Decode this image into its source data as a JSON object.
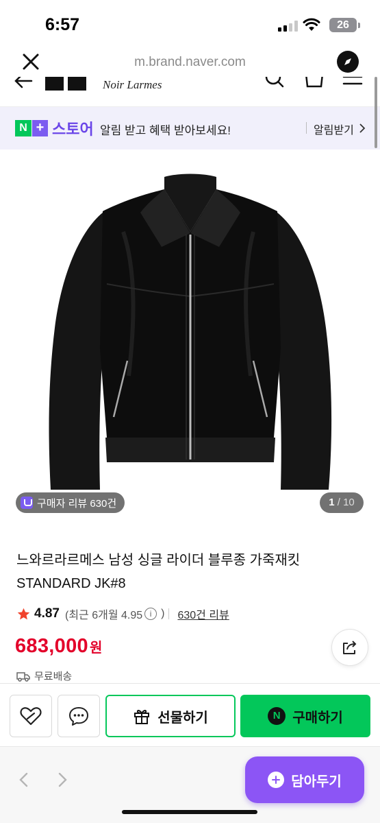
{
  "status_bar": {
    "time": "6:57",
    "battery": "26"
  },
  "browser": {
    "url": "m.brand.naver.com"
  },
  "site_header": {
    "brand": "Noir Larmes"
  },
  "store_banner": {
    "logo_n": "N",
    "logo_plus": "+",
    "store_name": "스토어",
    "message": "알림 받고 혜택 받아보세요!",
    "notify_label": "알림받기"
  },
  "gallery": {
    "review_chip": "구매자 리뷰 630건",
    "current": "1",
    "total": "/ 10"
  },
  "product": {
    "title_line1": "느와르라르메스 남성 싱글 라이더 블루종 가죽재킷",
    "title_line2": "STANDARD JK#8",
    "rating": "4.87",
    "recent_rating": "(최근 6개월 4.95",
    "recent_rating_close": ")",
    "info_glyph": "i",
    "review_count": "630건 리뷰",
    "price": "683,000",
    "price_unit": "원",
    "shipping": "무료배송"
  },
  "actions": {
    "gift_label": "선물하기",
    "buy_label": "구매하기",
    "npay_glyph": "N"
  },
  "browser_toolbar": {
    "save_label": "담아두기"
  },
  "colors": {
    "naver_green": "#03c75a",
    "store_purple": "#7b5cf0",
    "price_red": "#e3002a",
    "save_button": "#8c55f5"
  }
}
